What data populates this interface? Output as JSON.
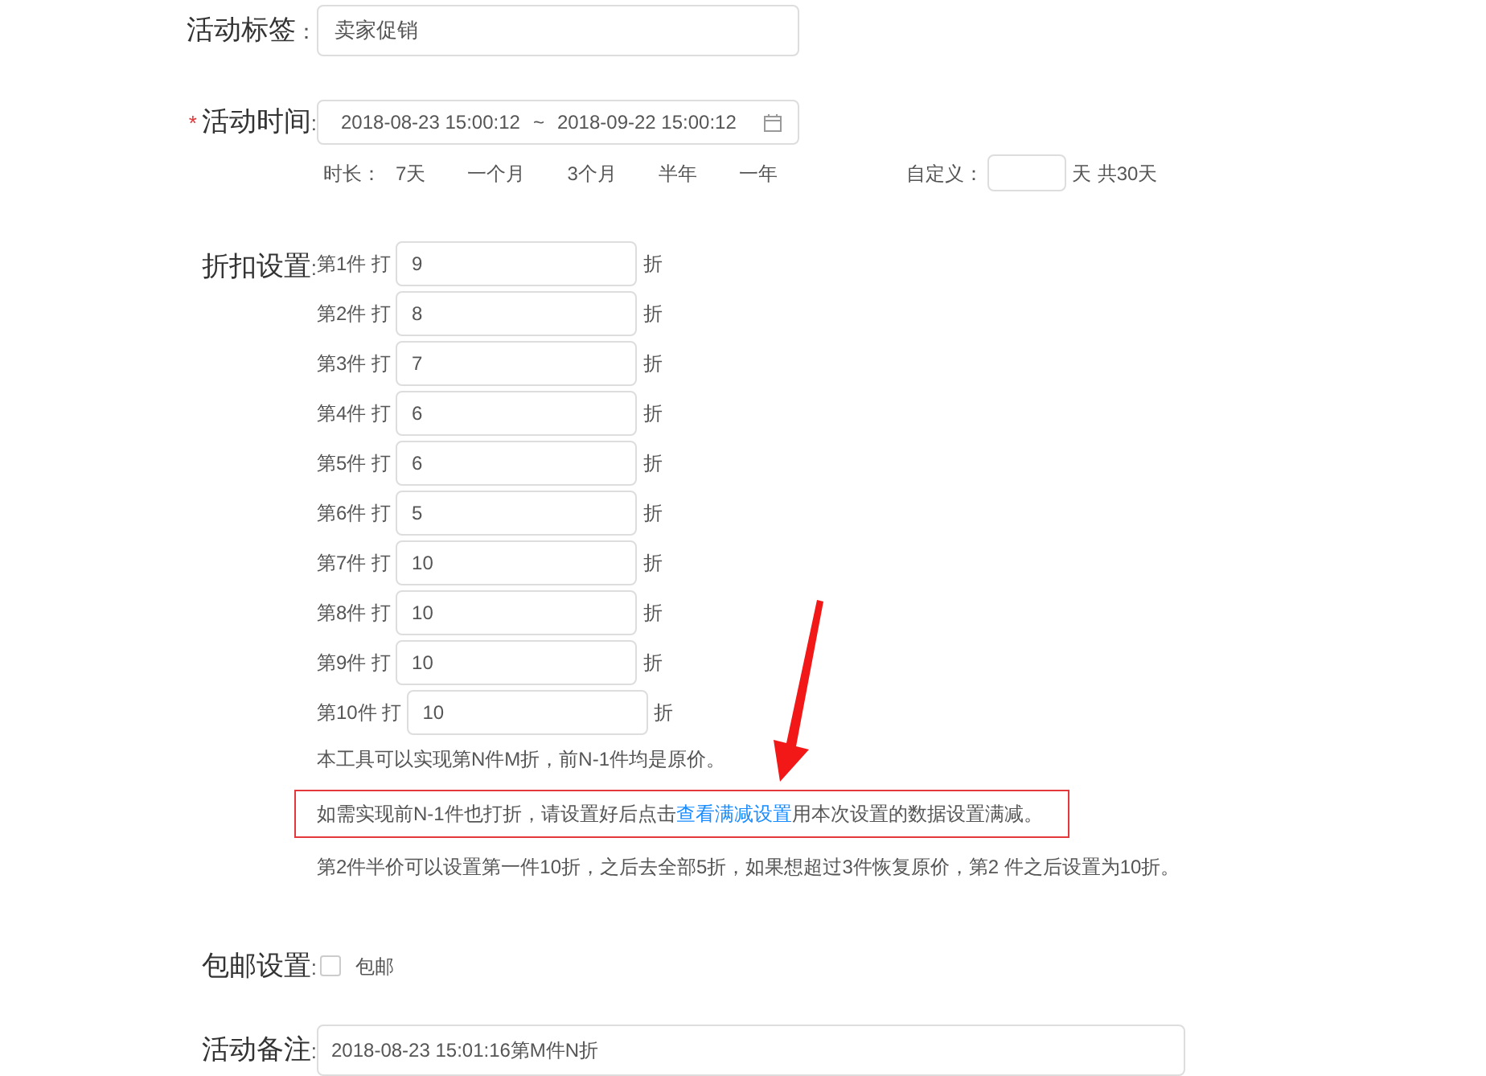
{
  "tag": {
    "label": "活动标签",
    "colon": "：",
    "value": "卖家促销"
  },
  "time": {
    "label": "活动时间",
    "required_mark": "*",
    "colon": ":",
    "start": "2018-08-23 15:00:12",
    "separator": "~",
    "end": "2018-09-22 15:00:12"
  },
  "duration": {
    "label": "时长：",
    "options": [
      "7天",
      "一个月",
      "3个月",
      "半年",
      "一年"
    ],
    "custom_label": "自定义：",
    "unit": "天",
    "total": "共30天"
  },
  "discount": {
    "label": "折扣设置",
    "colon": ":",
    "rows": [
      {
        "prefix": "第1件 打",
        "value": "9",
        "suffix": "折"
      },
      {
        "prefix": "第2件 打",
        "value": "8",
        "suffix": "折"
      },
      {
        "prefix": "第3件 打",
        "value": "7",
        "suffix": "折"
      },
      {
        "prefix": "第4件 打",
        "value": "6",
        "suffix": "折"
      },
      {
        "prefix": "第5件 打",
        "value": "6",
        "suffix": "折"
      },
      {
        "prefix": "第6件 打",
        "value": "5",
        "suffix": "折"
      },
      {
        "prefix": "第7件 打",
        "value": "10",
        "suffix": "折"
      },
      {
        "prefix": "第8件 打",
        "value": "10",
        "suffix": "折"
      },
      {
        "prefix": "第9件 打",
        "value": "10",
        "suffix": "折"
      },
      {
        "prefix": "第10件 打",
        "value": "10",
        "suffix": "折"
      }
    ],
    "note1": "本工具可以实现第N件M折，前N-1件均是原价。",
    "note2_before": "如需实现前N-1件也打折，请设置好后点击",
    "note2_link": "查看满减设置",
    "note2_after": "用本次设置的数据设置满减。",
    "note3": "第2件半价可以设置第一件10折，之后去全部5折，如果想超过3件恢复原价，第2 件之后设置为10折。"
  },
  "shipping": {
    "label": "包邮设置",
    "colon": ":",
    "option": "包邮",
    "checked": false
  },
  "remark": {
    "label": "活动备注",
    "colon": ":",
    "value": "2018-08-23 15:01:16第M件N折"
  }
}
